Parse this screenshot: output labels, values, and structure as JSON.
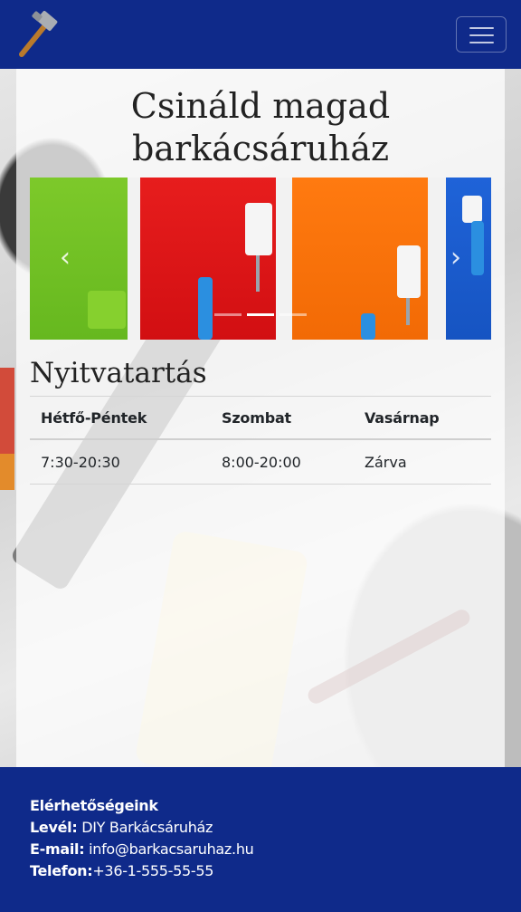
{
  "navbar": {
    "logo_icon": "hammer-icon",
    "toggler_icon": "hamburger-menu-icon"
  },
  "main": {
    "title": "Csináld magad barkácsáruház",
    "carousel": {
      "prev_icon": "chevron-left-icon",
      "next_icon": "chevron-right-icon",
      "slides": 3,
      "active_slide": 2
    },
    "hours": {
      "title": "Nyitvatartás",
      "headers": [
        "Hétfő-Péntek",
        "Szombat",
        "Vasárnap"
      ],
      "rows": [
        [
          "7:30-20:30",
          "8:00-20:00",
          "Zárva"
        ]
      ]
    }
  },
  "footer": {
    "heading": "Elérhetőségeink",
    "mail_label": "Levél:",
    "mail_value": " DIY Barkácsáruház",
    "email_label": "E-mail:",
    "email_value": " info@barkacsaruhaz.hu",
    "phone_label": "Telefon:",
    "phone_value": "+36-1-555-55-55"
  },
  "colors": {
    "navbar_bg": "#0f2a8a",
    "footer_bg": "#0f2a8a"
  }
}
